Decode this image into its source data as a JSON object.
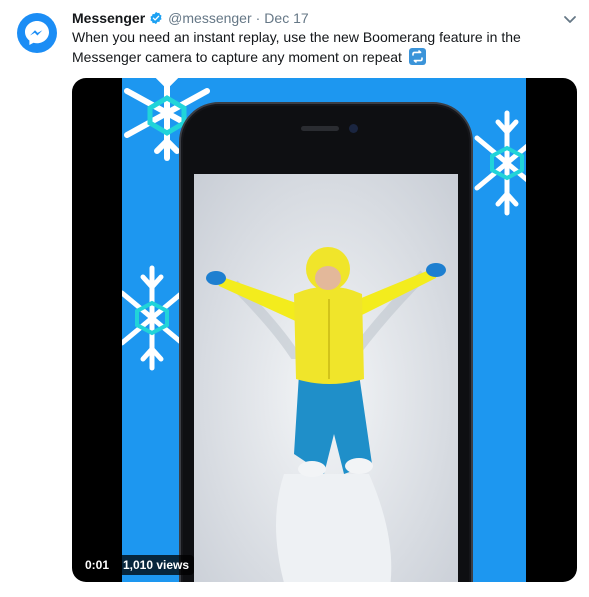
{
  "author": {
    "name": "Messenger",
    "handle": "@messenger",
    "separator": "·",
    "date": "Dec 17",
    "avatar_icon": "messenger-logo-icon",
    "verified_icon": "verified-badge-icon"
  },
  "tweet": {
    "text": "When you need an instant replay, use the new Boomerang feature in the Messenger camera to capture any moment on repeat",
    "emoji_icon": "repeat-emoji-icon"
  },
  "video": {
    "time": "0:01",
    "views": "1,010 views"
  },
  "menu": {
    "icon": "chevron-down-icon"
  },
  "colors": {
    "brand": "#1b8df5",
    "video_background": "#1d97f0",
    "verified": "#1da1f2"
  }
}
